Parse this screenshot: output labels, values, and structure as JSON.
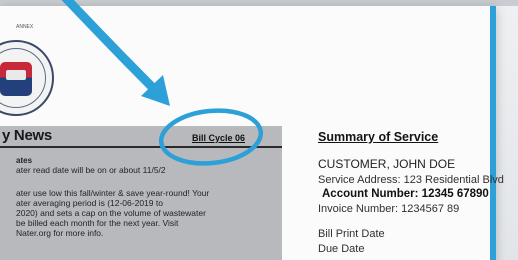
{
  "header": {
    "small_text": "ANNEX"
  },
  "news": {
    "title": "y News",
    "bill_cycle": "Bill Cycle 06",
    "lines": [
      "ates",
      "ater read date will be on or about 11/5/2",
      "ater use low this fall/winter & save year-round! Your",
      "ater averaging period is (12-06-2019 to",
      "2020) and sets a cap on the volume of wastewater",
      "be billed each month for the next year. Visit",
      "Nater.org for more info."
    ]
  },
  "summary": {
    "title": "Summary of Service",
    "customer": "CUSTOMER, JOHN DOE",
    "service_address": "Service Address: 123 Residential Blvd",
    "account_number": "Account Number: 12345 67890",
    "invoice_number": "Invoice Number: 1234567 89",
    "bill_print_date": "Bill Print Date",
    "due_date": "Due Date"
  },
  "colors": {
    "annotation": "#2ea0d8",
    "panel": "#b8b9bc"
  },
  "icons": {
    "seal": "city-seal-icon",
    "arrow": "annotation-arrow-icon",
    "circle": "annotation-circle-icon"
  }
}
